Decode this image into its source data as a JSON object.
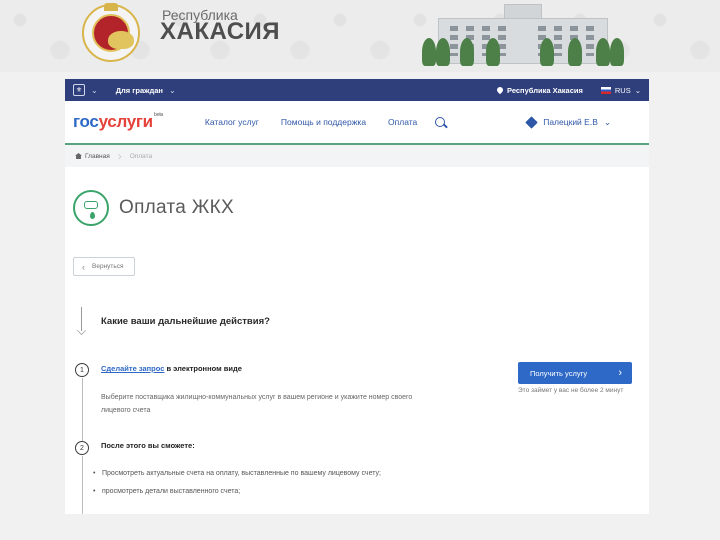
{
  "banner": {
    "region_subtitle": "Республика",
    "region_name": "ХАКАСИЯ"
  },
  "topbar": {
    "citizens_label": "Для граждан",
    "location": "Республика Хакасия",
    "language": "RUS"
  },
  "navbar": {
    "logo_part1": "гос",
    "logo_part2": "услуги",
    "logo_beta": "beta",
    "links": [
      "Каталог услуг",
      "Помощь и поддержка",
      "Оплата"
    ],
    "user_name": "Палецкий Е.В"
  },
  "breadcrumb": {
    "home": "Главная",
    "current": "Оплата"
  },
  "page": {
    "title": "Оплата ЖКХ",
    "back_label": "Вернуться",
    "question": "Какие ваши дальнейшие действия?"
  },
  "step1": {
    "number": "1",
    "link_text": "Сделайте запрос",
    "head_rest": " в электронном виде",
    "description": "Выберите поставщика жилищно-коммунальных услуг в вашем регионе и укажите номер своего лицевого счета",
    "button_label": "Получить услугу",
    "time_note": "Это займет у вас не более 2 минут"
  },
  "step2": {
    "number": "2",
    "head": "После этого вы сможете:",
    "bullets": [
      "Просмотреть актуальные счета на оплату, выставленные по вашему лицевому счету;",
      "просмотреть детали выставленного счета;"
    ]
  },
  "colors": {
    "topbar": "#2f3f7c",
    "accent_green": "#3aa46b",
    "primary_blue": "#2f69c7",
    "logo_red": "#e4423a"
  }
}
